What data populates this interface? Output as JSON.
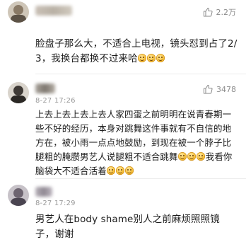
{
  "comments": [
    {
      "likes": "2.2万",
      "text_parts": [
        "脸盘子那么大，不适合上电视，镜头怼到占了2/3，我换台都换不过来哈"
      ],
      "emoji_count": 3
    },
    {
      "time": "8-27 17:26",
      "likes": "3478",
      "text_main": "上去上去上去上去人家四蛋之前明明在说青春期一些不好的经历，本身对跳舞这件事就有不自信的地方在，被小雨一点点地鼓励，到现在被一个脖子比腿粗的腌臜男艺人说腿粗不适合跳舞",
      "text_mid": "我看你脑袋大不适合活着"
    },
    {
      "time": "8-27 17:29",
      "likes": "",
      "text": "男艺人在body shame别人之前麻烦照照镜子，谢谢"
    }
  ],
  "icons": {
    "like": "thumbs-up-icon",
    "emoji": "laughing-emoji-icon",
    "smile": "smiling-emoji-icon"
  },
  "colors": {
    "meta": "#9a9a9a",
    "text": "#1c1c1c",
    "emoji": "#f7c23c"
  }
}
